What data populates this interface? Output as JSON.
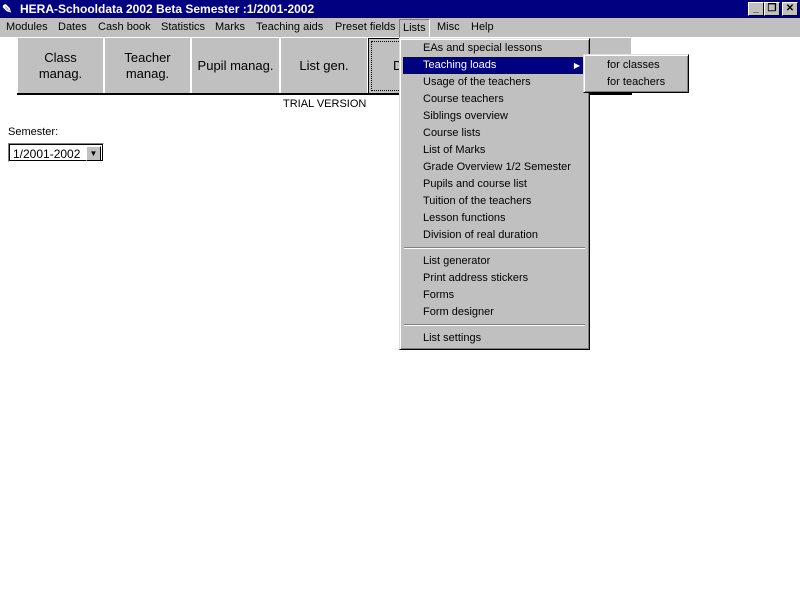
{
  "window": {
    "title": "HERA-Schooldata 2002 Beta Semester :1/2001-2002",
    "minimize": "_",
    "restore": "❐",
    "close": "✕"
  },
  "menubar": [
    "Modules",
    "Dates",
    "Cash book",
    "Statistics",
    "Marks",
    "Teaching aids",
    "Preset fields",
    "Lists",
    "Misc",
    "Help"
  ],
  "toolbar": {
    "buttons": [
      "Class\nmanag.",
      "Teacher\nmanag.",
      "Pupil manag.",
      "List gen.",
      "D"
    ]
  },
  "trial": "TRIAL VERSION",
  "semester": {
    "label": "Semester:",
    "value": "1/2001-2002"
  },
  "lists_menu": {
    "group1": [
      "EAs and special lessons",
      "Teaching loads",
      "Usage of the teachers",
      "Course teachers",
      "Siblings overview",
      "Course lists",
      "List of Marks",
      "Grade Overview 1/2 Semester",
      "Pupils and course list",
      "Tuition of the teachers",
      "Lesson functions",
      "Division of real duration"
    ],
    "group2": [
      "List generator",
      "Print address stickers",
      "Forms",
      "Form designer"
    ],
    "group3": [
      "List settings"
    ],
    "highlighted": "Teaching loads"
  },
  "submenu": [
    "for classes",
    "for teachers"
  ],
  "colors": {
    "titlebar": "#000080",
    "face": "#c0c0c0",
    "highlight": "#000080"
  }
}
